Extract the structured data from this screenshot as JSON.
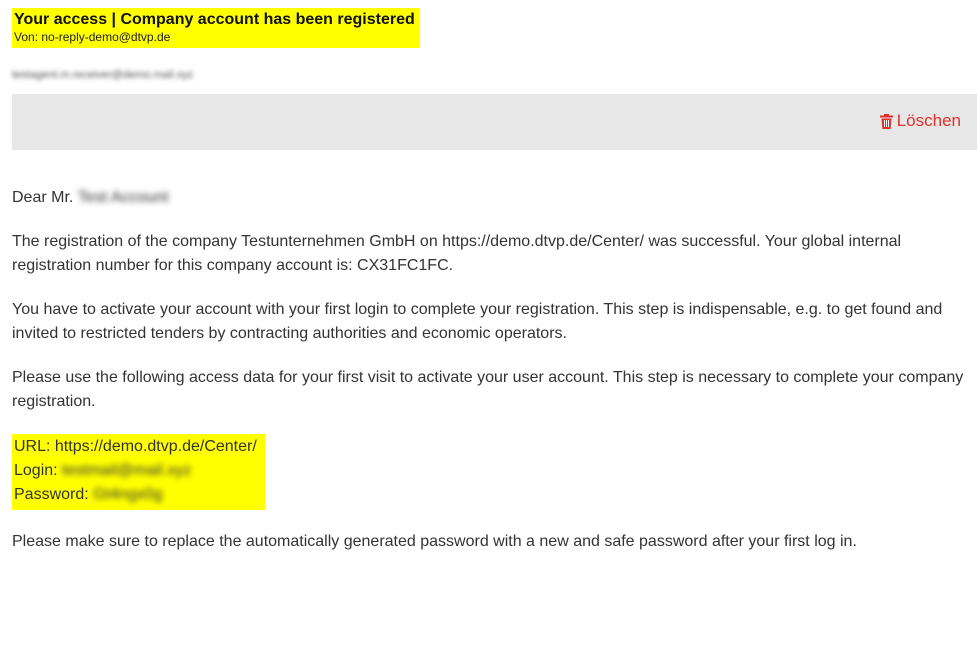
{
  "email": {
    "subject": "Your access | Company account has been registered",
    "from_label": "Von:",
    "from_address": "no-reply-demo@dtvp.de",
    "recipient_blurred": "testagent.m.receiver@demo.mail.xyz"
  },
  "toolbar": {
    "delete_label": "Löschen",
    "delete_color": "#e0312d"
  },
  "body": {
    "greeting_prefix": "Dear Mr.",
    "greeting_name_blurred": "Test Account",
    "para1": "The registration of the company Testunternehmen GmbH on https://demo.dtvp.de/Center/ was successful. Your global internal registration number for this company account is: CX31FC1FC.",
    "para2": "You have to activate your account with your first login to complete your registration. This step is indispensable, e.g. to get found and invited to restricted tenders by contracting authorities and economic operators.",
    "para3": "Please use the following access data for your first visit to activate your user account. This step is necessary to complete your company registration.",
    "access": {
      "url_line": "URL: https://demo.dtvp.de/Center/",
      "login_label": "Login:",
      "login_blurred": "testmail@mail.xyz",
      "password_label": "Password:",
      "password_blurred": "Gt4ngx0g"
    },
    "para4": "Please make sure to replace the automatically generated password with a new and safe password after your first log in."
  },
  "colors": {
    "highlight": "#ffff00",
    "toolbar_bg": "#e7e7e7",
    "text": "#333333"
  }
}
